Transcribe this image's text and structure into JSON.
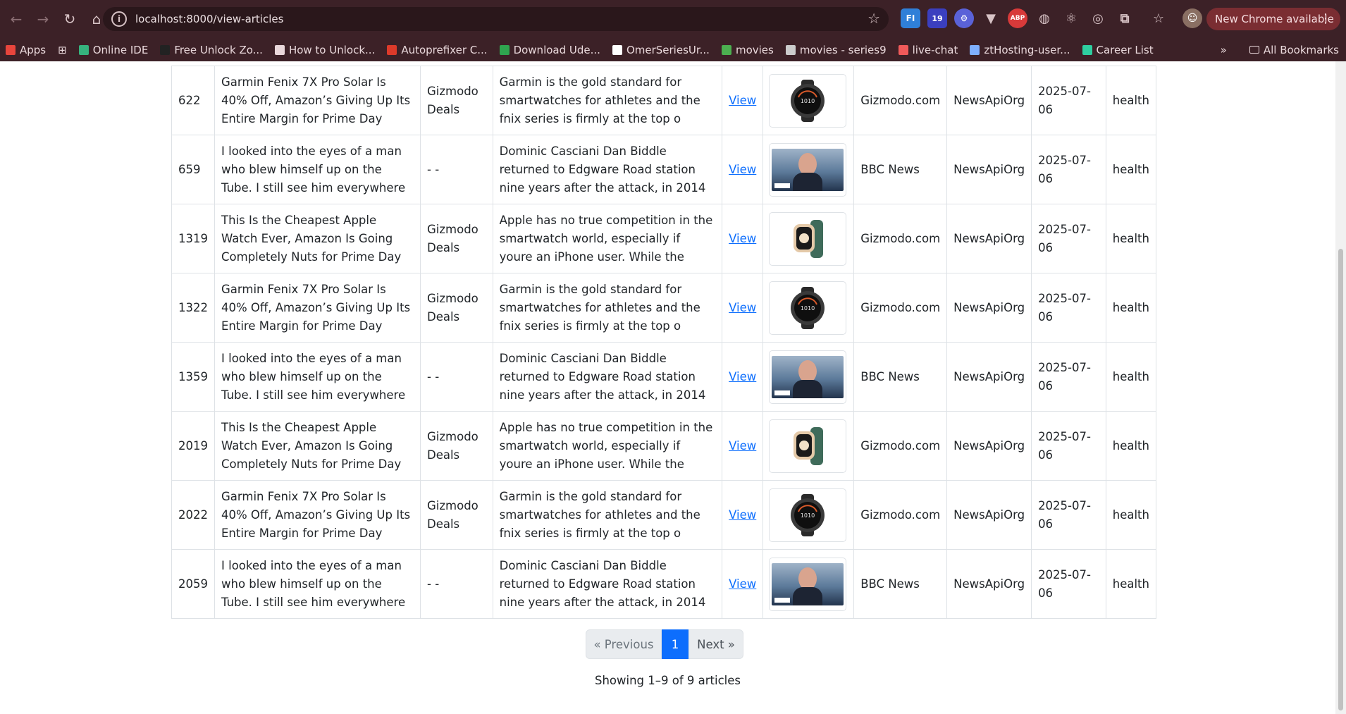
{
  "browser": {
    "url": "localhost:8000/view-articles",
    "new_chrome_label": "New Chrome available",
    "extension_badge": "19",
    "bookmarks": [
      {
        "label": "Apps",
        "color": "#e8453c"
      },
      {
        "label": "Online IDE",
        "color": "#36b37e"
      },
      {
        "label": "Free Unlock Zo...",
        "color": "#222222"
      },
      {
        "label": "How to Unlock...",
        "color": "#e9d7da"
      },
      {
        "label": "Autoprefixer C...",
        "color": "#dd3a2a"
      },
      {
        "label": "Download Ude...",
        "color": "#2fa44f"
      },
      {
        "label": "OmerSeriesUr...",
        "color": "#ffffff"
      },
      {
        "label": "movies",
        "color": "#4caf50"
      },
      {
        "label": "movies - series9",
        "color": "#cccccc"
      },
      {
        "label": "live-chat",
        "color": "#f05a5a"
      },
      {
        "label": "ztHosting-user...",
        "color": "#7fb0ff"
      },
      {
        "label": "Career List",
        "color": "#2ecfa0"
      }
    ],
    "all_bookmarks_label": "All Bookmarks"
  },
  "articles": [
    {
      "id": "622",
      "title": "Garmin Fenix 7X Pro Solar Is 40% Off, Amazon’s Giving Up Its Entire Margin for Prime Day",
      "author": "Gizmodo Deals",
      "description": "Garmin is the gold standard for smartwatches for athletes and the fnix series is firmly at the top o",
      "link": "View",
      "image": "garmin-watch",
      "source": "Gizmodo.com",
      "api": "NewsApiOrg",
      "date": "2025-07-06",
      "category": "health"
    },
    {
      "id": "659",
      "title": "I looked into the eyes of a man who blew himself up on the Tube. I still see him everywhere",
      "author": "- -",
      "description": "Dominic Casciani Dan Biddle returned to Edgware Road station nine years after the attack, in 2014",
      "link": "View",
      "image": "bbc-photo",
      "source": "BBC News",
      "api": "NewsApiOrg",
      "date": "2025-07-06",
      "category": "health"
    },
    {
      "id": "1319",
      "title": "This Is the Cheapest Apple Watch Ever, Amazon Is Going Completely Nuts for Prime Day",
      "author": "Gizmodo Deals",
      "description": "Apple has no true competition in the smartwatch world, especially if youre an iPhone user. While the",
      "link": "View",
      "image": "apple-watch",
      "source": "Gizmodo.com",
      "api": "NewsApiOrg",
      "date": "2025-07-06",
      "category": "health"
    },
    {
      "id": "1322",
      "title": "Garmin Fenix 7X Pro Solar Is 40% Off, Amazon’s Giving Up Its Entire Margin for Prime Day",
      "author": "Gizmodo Deals",
      "description": "Garmin is the gold standard for smartwatches for athletes and the fnix series is firmly at the top o",
      "link": "View",
      "image": "garmin-watch",
      "source": "Gizmodo.com",
      "api": "NewsApiOrg",
      "date": "2025-07-06",
      "category": "health"
    },
    {
      "id": "1359",
      "title": "I looked into the eyes of a man who blew himself up on the Tube. I still see him everywhere",
      "author": "- -",
      "description": "Dominic Casciani Dan Biddle returned to Edgware Road station nine years after the attack, in 2014",
      "link": "View",
      "image": "bbc-photo",
      "source": "BBC News",
      "api": "NewsApiOrg",
      "date": "2025-07-06",
      "category": "health"
    },
    {
      "id": "2019",
      "title": "This Is the Cheapest Apple Watch Ever, Amazon Is Going Completely Nuts for Prime Day",
      "author": "Gizmodo Deals",
      "description": "Apple has no true competition in the smartwatch world, especially if youre an iPhone user. While the",
      "link": "View",
      "image": "apple-watch",
      "source": "Gizmodo.com",
      "api": "NewsApiOrg",
      "date": "2025-07-06",
      "category": "health"
    },
    {
      "id": "2022",
      "title": "Garmin Fenix 7X Pro Solar Is 40% Off, Amazon’s Giving Up Its Entire Margin for Prime Day",
      "author": "Gizmodo Deals",
      "description": "Garmin is the gold standard for smartwatches for athletes and the fnix series is firmly at the top o",
      "link": "View",
      "image": "garmin-watch",
      "source": "Gizmodo.com",
      "api": "NewsApiOrg",
      "date": "2025-07-06",
      "category": "health"
    },
    {
      "id": "2059",
      "title": "I looked into the eyes of a man who blew himself up on the Tube. I still see him everywhere",
      "author": "- -",
      "description": "Dominic Casciani Dan Biddle returned to Edgware Road station nine years after the attack, in 2014",
      "link": "View",
      "image": "bbc-photo",
      "source": "BBC News",
      "api": "NewsApiOrg",
      "date": "2025-07-06",
      "category": "health"
    }
  ],
  "pagination": {
    "previous": "« Previous",
    "current": "1",
    "next": "Next »"
  },
  "summary": "Showing 1–9 of 9 articles"
}
